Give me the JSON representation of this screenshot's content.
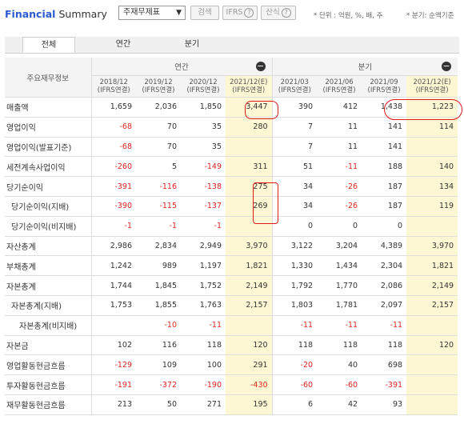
{
  "header": {
    "title_a": "Financial",
    "title_b": "Summary",
    "select_value": "주재무제표",
    "btn_search": "검색",
    "btn_ifrs": "IFRS",
    "btn_formula": "산식",
    "unit": "* 단위 : 억원, %, 배, 주",
    "basis": "* 분기: 순액기준"
  },
  "tabs": [
    "전체",
    "연간",
    "분기"
  ],
  "table": {
    "row_header": "주요재무정보",
    "group_annual": "연간",
    "group_quarter": "분기",
    "columns": [
      [
        "2018/12",
        "(IFRS연결)"
      ],
      [
        "2019/12",
        "(IFRS연결)"
      ],
      [
        "2020/12",
        "(IFRS연결)"
      ],
      [
        "2021/12(E)",
        "(IFRS연결)"
      ],
      [
        "2021/03",
        "(IFRS연결)"
      ],
      [
        "2021/06",
        "(IFRS연결)"
      ],
      [
        "2021/09",
        "(IFRS연결)"
      ],
      [
        "2021/12(E)",
        "(IFRS연결)"
      ]
    ],
    "rows": [
      {
        "label": "매출액",
        "indent": 0,
        "values": [
          "1,659",
          "2,036",
          "1,850",
          "3,447",
          "390",
          "412",
          "1,438",
          "1,223"
        ]
      },
      {
        "label": "영업이익",
        "indent": 0,
        "values": [
          "-68",
          "70",
          "35",
          "280",
          "7",
          "11",
          "141",
          "114"
        ]
      },
      {
        "label": "영업이익(발표기준)",
        "indent": 0,
        "values": [
          "-68",
          "70",
          "35",
          "",
          "7",
          "11",
          "141",
          ""
        ]
      },
      {
        "label": "세전계속사업이익",
        "indent": 0,
        "values": [
          "-260",
          "5",
          "-149",
          "311",
          "51",
          "-11",
          "188",
          "140"
        ]
      },
      {
        "label": "당기순이익",
        "indent": 0,
        "values": [
          "-391",
          "-116",
          "-138",
          "275",
          "34",
          "-26",
          "187",
          "134"
        ]
      },
      {
        "label": "당기순이익(지배)",
        "indent": 1,
        "values": [
          "-390",
          "-115",
          "-137",
          "269",
          "34",
          "-26",
          "187",
          "119"
        ]
      },
      {
        "label": "당기순이익(비지배)",
        "indent": 1,
        "values": [
          "-1",
          "-1",
          "-1",
          "",
          "0",
          "0",
          "0",
          ""
        ]
      },
      {
        "label": "자산총계",
        "indent": 0,
        "values": [
          "2,986",
          "2,834",
          "2,949",
          "3,970",
          "3,122",
          "3,204",
          "4,389",
          "3,970"
        ]
      },
      {
        "label": "부채총계",
        "indent": 0,
        "values": [
          "1,242",
          "989",
          "1,197",
          "1,821",
          "1,330",
          "1,434",
          "2,304",
          "1,821"
        ]
      },
      {
        "label": "자본총계",
        "indent": 0,
        "values": [
          "1,744",
          "1,845",
          "1,752",
          "2,149",
          "1,792",
          "1,770",
          "2,086",
          "2,149"
        ]
      },
      {
        "label": "자본총계(지배)",
        "indent": 1,
        "values": [
          "1,753",
          "1,855",
          "1,763",
          "2,157",
          "1,803",
          "1,781",
          "2,097",
          "2,157"
        ]
      },
      {
        "label": "자본총계(비지배)",
        "indent": 2,
        "values": [
          "",
          "-10",
          "-11",
          "",
          "-11",
          "-11",
          "-11",
          ""
        ]
      },
      {
        "label": "자본금",
        "indent": 0,
        "values": [
          "102",
          "116",
          "118",
          "120",
          "118",
          "118",
          "118",
          "120"
        ]
      },
      {
        "label": "영업활동현금흐름",
        "indent": 0,
        "values": [
          "-129",
          "109",
          "100",
          "291",
          "-20",
          "40",
          "698",
          ""
        ]
      },
      {
        "label": "투자활동현금흐름",
        "indent": 0,
        "values": [
          "-191",
          "-372",
          "-190",
          "-430",
          "-60",
          "-60",
          "-391",
          ""
        ]
      },
      {
        "label": "재무활동현금흐름",
        "indent": 0,
        "values": [
          "213",
          "50",
          "271",
          "195",
          "6",
          "42",
          "93",
          ""
        ]
      }
    ]
  },
  "colors": {
    "negative": "#e0281f",
    "estimate_bg": "#fdf8d3",
    "annotation": "#e01a1a",
    "brand": "#2a5ad3"
  }
}
